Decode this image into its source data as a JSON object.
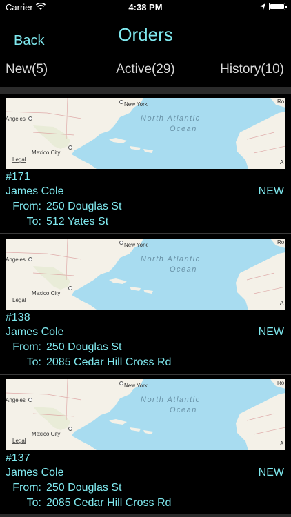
{
  "status_bar": {
    "carrier": "Carrier",
    "time": "4:38 PM"
  },
  "nav": {
    "back_label": "Back",
    "title": "Orders"
  },
  "tabs": [
    {
      "label": "New(5)"
    },
    {
      "label": "Active(29)"
    },
    {
      "label": "History(10)"
    }
  ],
  "map": {
    "labels": [
      "New York",
      "North Atlantic",
      "Ocean",
      "Angeles",
      "Mexico City",
      "Legal",
      "Ro",
      "A"
    ]
  },
  "orders": [
    {
      "number": "#171",
      "customer": "James Cole",
      "status": "NEW",
      "from_label": "From:",
      "from": "250 Douglas St",
      "to_label": "To:",
      "to": "512 Yates St"
    },
    {
      "number": "#138",
      "customer": "James Cole",
      "status": "NEW",
      "from_label": "From:",
      "from": "250 Douglas St",
      "to_label": "To:",
      "to": "2085 Cedar Hill Cross Rd"
    },
    {
      "number": "#137",
      "customer": "James Cole",
      "status": "NEW",
      "from_label": "From:",
      "from": "250 Douglas St",
      "to_label": "To:",
      "to": "2085 Cedar Hill Cross Rd"
    }
  ],
  "colors": {
    "accent": "#7fe8ee",
    "background": "#000000",
    "separator": "#2b2b2b",
    "water": "#a8dcf0",
    "land": "#f4f1e8"
  }
}
